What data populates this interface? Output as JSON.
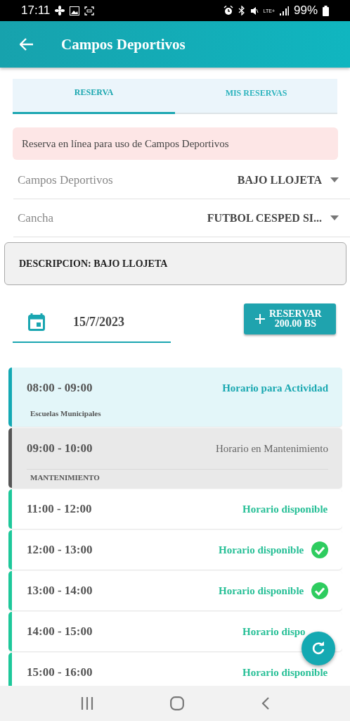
{
  "status_bar": {
    "time": "17:11",
    "network": "LTE+",
    "battery": "99%"
  },
  "header": {
    "title": "Campos Deportivos"
  },
  "tabs": [
    {
      "label": "RESERVA",
      "selected": true
    },
    {
      "label": "MIS RESERVAS",
      "selected": false
    }
  ],
  "alert": "Reserva en línea para uso de Campos Deportivos",
  "selects": [
    {
      "label": "Campos Deportivos",
      "value": "BAJO LLOJETA"
    },
    {
      "label": "Cancha",
      "value": "FUTBOL CESPED SI..."
    }
  ],
  "description": "DESCRIPCION: BAJO LLOJETA",
  "date": {
    "value": "15/7/2023"
  },
  "reserve_button": {
    "lines": [
      "RESERVAR",
      "200.00 BS"
    ]
  },
  "slots": [
    {
      "kind": "activity",
      "time": "08:00 - 09:00",
      "status": "Horario para Actividad",
      "note": "Escuelas Municipales",
      "checked": false
    },
    {
      "kind": "maintenance",
      "time": "09:00 - 10:00",
      "status": "Horario en Mantenimiento",
      "note": "MANTENIMIENTO",
      "checked": false
    },
    {
      "kind": "available",
      "time": "11:00 - 12:00",
      "status": "Horario disponible",
      "checked": false
    },
    {
      "kind": "available",
      "time": "12:00 - 13:00",
      "status": "Horario disponible",
      "checked": true
    },
    {
      "kind": "available",
      "time": "13:00 - 14:00",
      "status": "Horario disponible",
      "checked": true
    },
    {
      "kind": "available",
      "time": "14:00 - 15:00",
      "status": "Horario dispo",
      "checked": false
    },
    {
      "kind": "available",
      "time": "15:00 - 16:00",
      "status": "Horario disponible",
      "checked": false
    }
  ]
}
